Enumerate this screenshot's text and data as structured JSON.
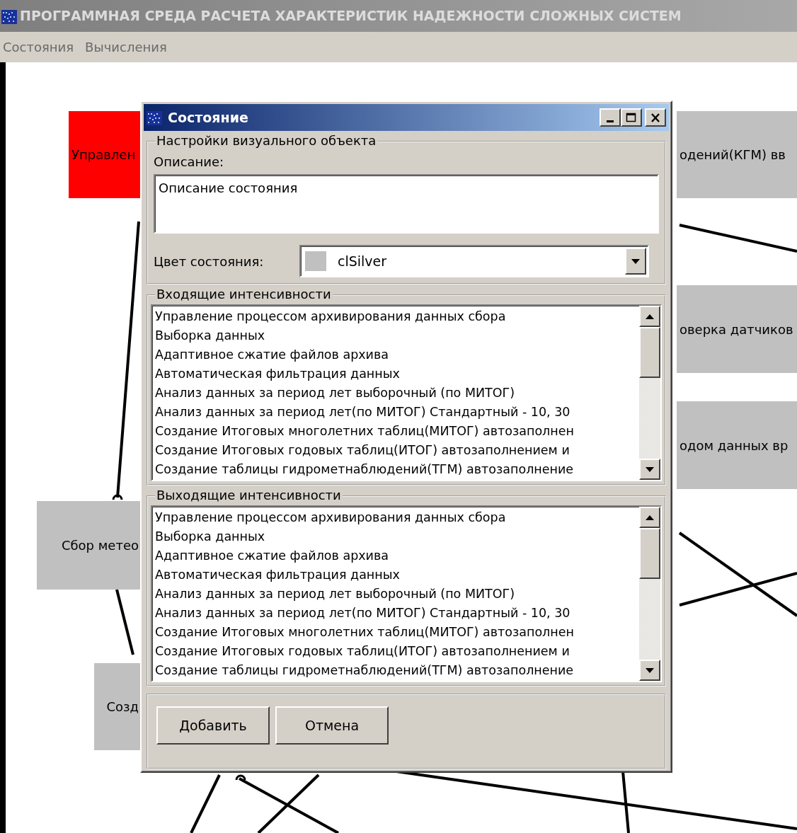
{
  "window": {
    "title": "ПРОГРАММНАЯ СРЕДА РАСЧЕТА ХАРАКТЕРИСТИК НАДЕЖНОСТИ СЛОЖНЫХ СИСТЕМ"
  },
  "menu": [
    {
      "label": "Состояния"
    },
    {
      "label": "Вычисления"
    }
  ],
  "canvas": {
    "nodes": [
      {
        "label": "Управлен",
        "color": "#ff0000"
      },
      {
        "label": "одений(КГМ) вв",
        "color": "#c0c0c0"
      },
      {
        "label": "оверка датчиков",
        "color": "#c0c0c0"
      },
      {
        "label": "одом данных вр",
        "color": "#c0c0c0"
      },
      {
        "label": "Сбор метео",
        "color": "#c0c0c0"
      },
      {
        "label": "Созд",
        "color": "#c0c0c0"
      }
    ]
  },
  "dialog": {
    "title": "Состояние",
    "settings": {
      "title": "Настройки визуального объекта",
      "description_label": "Описание:",
      "description_value": "Описание состояния",
      "color_label": "Цвет состояния:",
      "color_value": "clSilver"
    },
    "incoming": {
      "title": "Входящие интенсивности",
      "items": [
        "Управление процессом архивирования данных сбора",
        "Выборка данных",
        "Адаптивное сжатие файлов архива",
        "Автоматическая фильтрация данных",
        "Анализ данных за период лет выборочный (по МИТОГ)",
        "Анализ данных за период лет(по МИТОГ) Стандартный - 10, 30",
        "Создание Итоговых многолетних таблиц(МИТОГ) автозаполнен",
        "Создание Итоговых годовых таблиц(ИТОГ) автозаполнением и",
        "Создание таблицы гидрометнаблюдений(ТГМ) автозаполнение"
      ]
    },
    "outgoing": {
      "title": "Выходящие интенсивности",
      "items": [
        "Управление процессом архивирования данных сбора",
        "Выборка данных",
        "Адаптивное сжатие файлов архива",
        "Автоматическая фильтрация данных",
        "Анализ данных за период лет выборочный (по МИТОГ)",
        "Анализ данных за период лет(по МИТОГ) Стандартный - 10, 30",
        "Создание Итоговых многолетних таблиц(МИТОГ) автозаполнен",
        "Создание Итоговых годовых таблиц(ИТОГ) автозаполнением и",
        "Создание таблицы гидрометнаблюдений(ТГМ) автозаполнение"
      ]
    },
    "buttons": [
      {
        "label": "Добавить"
      },
      {
        "label": "Отмена"
      }
    ]
  }
}
